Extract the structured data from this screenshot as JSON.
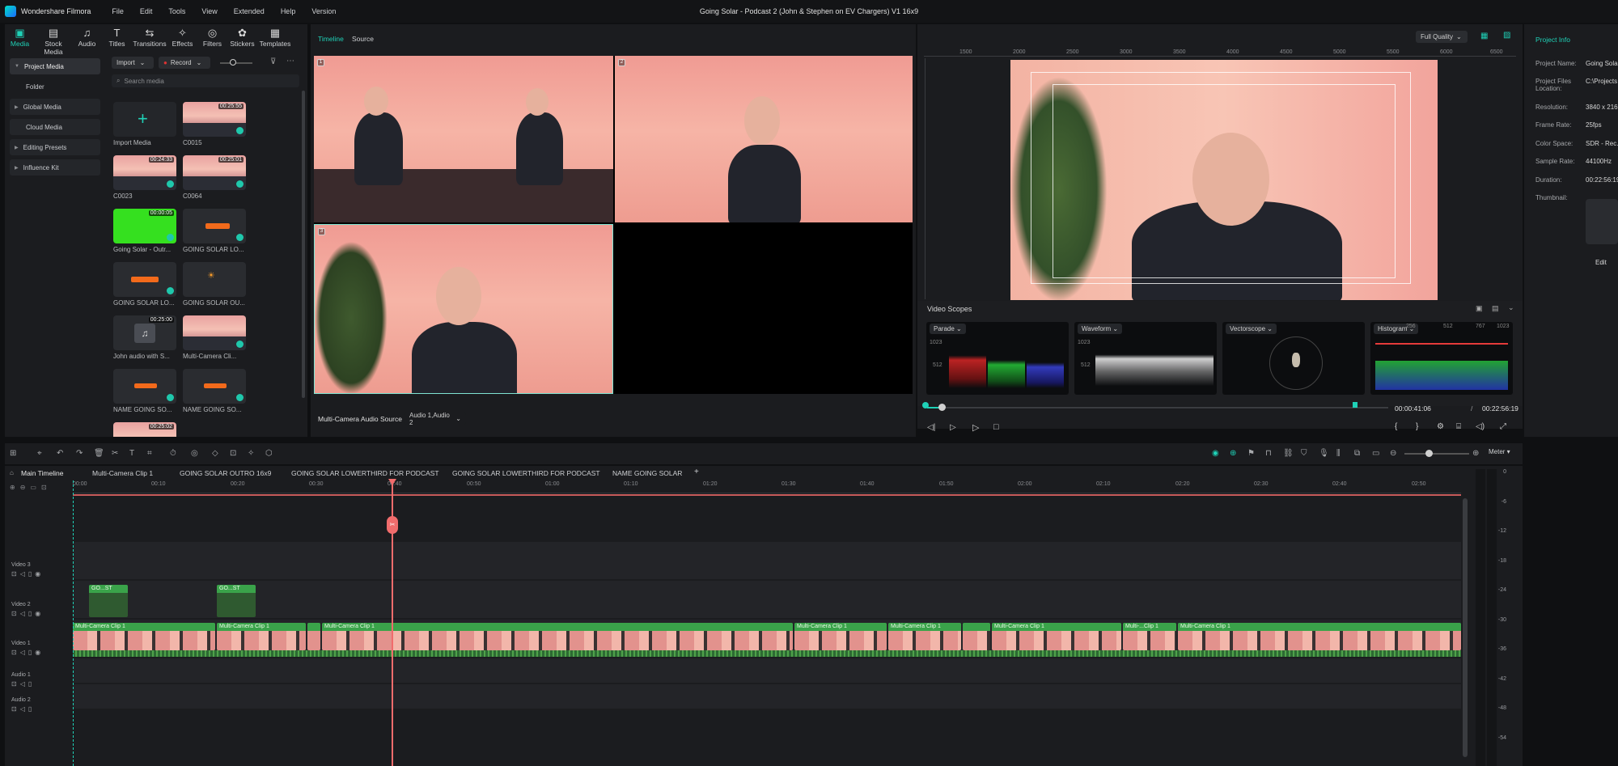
{
  "app": {
    "name": "Wondershare Filmora",
    "window_title": "Going Solar - Podcast 2 (John & Stephen on EV Chargers) V1 16x9",
    "menu": [
      "File",
      "Edit",
      "Tools",
      "View",
      "Extended",
      "Help",
      "Version"
    ]
  },
  "media_tabs": [
    {
      "label": "Media",
      "icon": "media-icon"
    },
    {
      "label": "Stock Media",
      "icon": "stock-icon"
    },
    {
      "label": "Audio",
      "icon": "audio-icon"
    },
    {
      "label": "Titles",
      "icon": "titles-icon"
    },
    {
      "label": "Transitions",
      "icon": "transitions-icon"
    },
    {
      "label": "Effects",
      "icon": "effects-icon"
    },
    {
      "label": "Filters",
      "icon": "filters-icon"
    },
    {
      "label": "Stickers",
      "icon": "stickers-icon"
    },
    {
      "label": "Templates",
      "icon": "templates-icon"
    }
  ],
  "sidebar": {
    "items": [
      "Project Media",
      "Folder",
      "Global Media",
      "Cloud Media",
      "Editing Presets",
      "Influence Kit"
    ]
  },
  "media_toolbar": {
    "import": "Import",
    "record": "Record",
    "search_placeholder": "Search media"
  },
  "media_items": [
    {
      "label": "Import Media",
      "duration": ""
    },
    {
      "label": "C0015",
      "duration": "00:25:55"
    },
    {
      "label": "C0023",
      "duration": "00:24:33"
    },
    {
      "label": "C0064",
      "duration": "00:25:01"
    },
    {
      "label": "Going Solar - Outr...",
      "duration": "00:00:05"
    },
    {
      "label": "GOING SOLAR LO...",
      "duration": ""
    },
    {
      "label": "GOING SOLAR LO...",
      "duration": ""
    },
    {
      "label": "GOING SOLAR OU...",
      "duration": ""
    },
    {
      "label": "John audio with S...",
      "duration": "00:25:00"
    },
    {
      "label": "Multi-Camera Cli...",
      "duration": ""
    },
    {
      "label": "NAME GOING SO...",
      "duration": ""
    },
    {
      "label": "NAME GOING SO...",
      "duration": ""
    },
    {
      "label": "",
      "duration": "00:25:02"
    }
  ],
  "player_tabs": {
    "timeline": "Timeline",
    "source": "Source"
  },
  "multicam": {
    "audio_source_label": "Multi-Camera Audio Source",
    "audio_source_value": "Audio 1,Audio 2",
    "angles": [
      "1",
      "2",
      "3"
    ]
  },
  "preview": {
    "quality": "Full Quality",
    "current_time": "00:00:41:06",
    "sep": "/",
    "total_time": "00:22:56:19",
    "ruler": [
      "1500",
      "2000",
      "2500",
      "3000",
      "3500",
      "4000",
      "4500",
      "5000",
      "5500",
      "6000",
      "6500",
      "7000"
    ]
  },
  "scopes": {
    "title": "Video Scopes",
    "items": [
      {
        "name": "Parade",
        "scale": [
          "1023",
          "512",
          "0"
        ]
      },
      {
        "name": "Waveform",
        "scale": [
          "1023",
          "512",
          "0"
        ]
      },
      {
        "name": "Vectorscope",
        "scale": []
      },
      {
        "name": "Histogram",
        "scale": [
          "256",
          "512",
          "767",
          "1023"
        ]
      }
    ]
  },
  "project_info": {
    "title": "Project Info",
    "rows": [
      {
        "k": "Project Name:",
        "v": "Going Sola"
      },
      {
        "k": "Project Files Location:",
        "v": "C:\\Projects"
      },
      {
        "k": "Resolution:",
        "v": "3840 x 2160"
      },
      {
        "k": "Frame Rate:",
        "v": "25fps"
      },
      {
        "k": "Color Space:",
        "v": "SDR - Rec."
      },
      {
        "k": "Sample Rate:",
        "v": "44100Hz"
      },
      {
        "k": "Duration:",
        "v": "00:22:56:19"
      },
      {
        "k": "Thumbnail:",
        "v": ""
      }
    ],
    "edit": "Edit"
  },
  "timeline": {
    "meter_label": "Meter",
    "tabs": [
      "Main Timeline",
      "Multi-Camera Clip 1",
      "GOING SOLAR OUTRO 16x9",
      "GOING SOLAR LOWERTHIRD FOR PODCAST",
      "GOING SOLAR LOWERTHIRD FOR PODCAST",
      "NAME GOING SOLAR"
    ],
    "ruler": [
      "00:00",
      "00:10",
      "00:20",
      "00:30",
      "00:40",
      "00:50",
      "01:00",
      "01:10",
      "01:20",
      "01:30",
      "01:40",
      "01:50",
      "02:00",
      "02:10",
      "02:20",
      "02:30",
      "02:40",
      "02:50"
    ],
    "tracks": [
      "Video 3",
      "Video 2",
      "Video 1",
      "Audio 1",
      "Audio 2"
    ],
    "video2_clips": [
      "GO...ST",
      "GO...ST"
    ],
    "video1_clips": [
      "Multi-Camera Clip 1",
      "Multi-Camera Clip 1",
      "",
      "Multi-Camera Clip 1",
      "Multi-Camera Clip 1",
      "Multi-Camera Clip 1",
      "",
      "Multi-Camera Clip 1",
      "Multi-...Clip 1",
      "Multi-Camera Clip 1"
    ],
    "meter_scale": [
      "0",
      "-6",
      "-12",
      "-18",
      "-24",
      "-30",
      "-36",
      "-42",
      "-48",
      "-54"
    ]
  },
  "colors": {
    "accent": "#1fd1b7",
    "playhead": "#f06c6c",
    "clip_green": "#3aa34a"
  }
}
